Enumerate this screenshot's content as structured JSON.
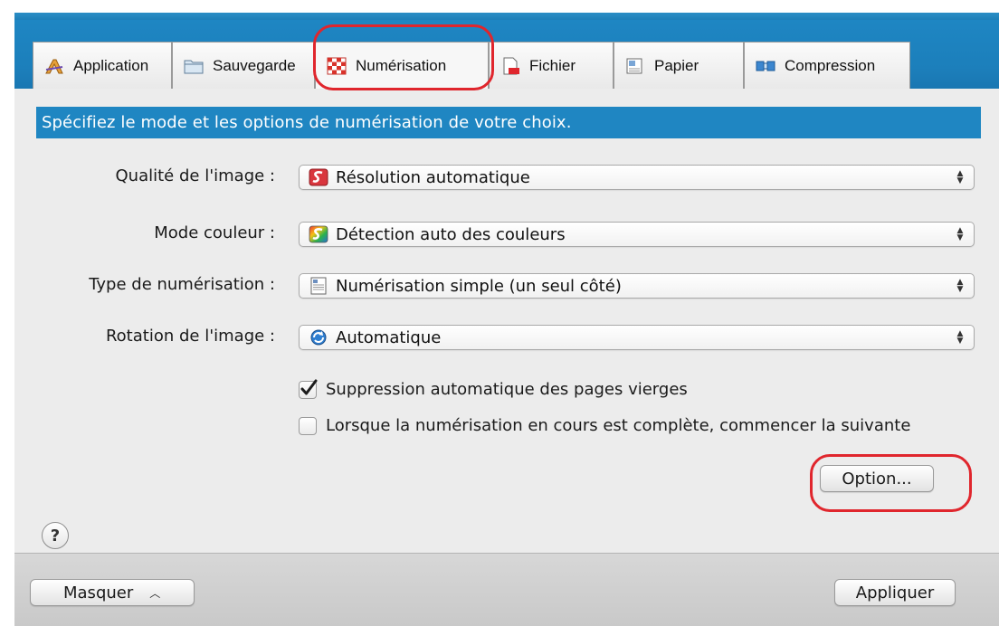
{
  "tabs": [
    {
      "label": "Application",
      "icon": "application-icon",
      "active": false
    },
    {
      "label": "Sauvegarde",
      "icon": "folder-icon",
      "active": false
    },
    {
      "label": "Numérisation",
      "icon": "scan-icon",
      "active": true
    },
    {
      "label": "Fichier",
      "icon": "file-icon",
      "active": false
    },
    {
      "label": "Papier",
      "icon": "paper-icon",
      "active": false
    },
    {
      "label": "Compression",
      "icon": "compression-icon",
      "active": false
    }
  ],
  "banner": "Spécifiez le mode et les options de numérisation de votre choix.",
  "fields": {
    "quality": {
      "label": "Qualité de l'image :",
      "value": "Résolution automatique",
      "icon": "resolution-icon"
    },
    "color_mode": {
      "label": "Mode couleur :",
      "value": "Détection auto des couleurs",
      "icon": "color-detect-icon"
    },
    "scan_type": {
      "label": "Type de numérisation :",
      "value": "Numérisation simple (un seul côté)",
      "icon": "single-side-icon"
    },
    "rotation": {
      "label": "Rotation de l'image :",
      "value": "Automatique",
      "icon": "rotation-icon"
    }
  },
  "checkboxes": {
    "blank_page": {
      "label": "Suppression automatique des pages vierges",
      "checked": true
    },
    "continue_scan": {
      "label": "Lorsque la numérisation en cours est complète, commencer la suivante",
      "checked": false
    }
  },
  "buttons": {
    "option": "Option...",
    "hide": "Masquer",
    "apply": "Appliquer",
    "help": "?"
  },
  "colors": {
    "accent": "#1f86c2",
    "highlight": "#e0262d"
  }
}
